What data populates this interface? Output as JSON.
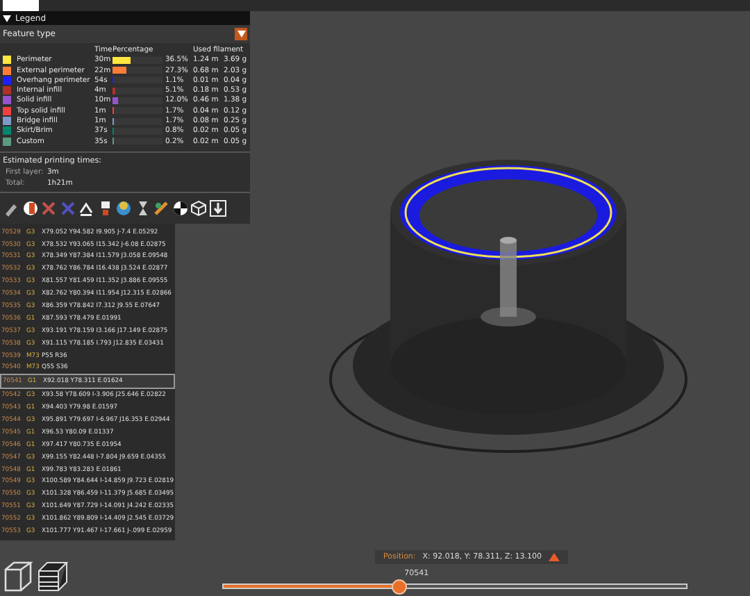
{
  "legend": {
    "title": "Legend",
    "expanded": true,
    "view_type": "Feature type",
    "columns": [
      "Time",
      "Percentage",
      "Used filament"
    ],
    "features": [
      {
        "name": "Perimeter",
        "color": "#ffe640",
        "time": "30m",
        "level": 0.365,
        "percentage": "36.5%",
        "length": "1.24 m",
        "weight": "3.69 g"
      },
      {
        "name": "External perimeter",
        "color": "#ff7d38",
        "time": "22m",
        "level": 0.273,
        "percentage": "27.3%",
        "length": "0.68 m",
        "weight": "2.03 g"
      },
      {
        "name": "Overhang perimeter",
        "color": "#1f1fff",
        "time": "54s",
        "level": 0.011,
        "percentage": "1.1%",
        "length": "0.01 m",
        "weight": "0.04 g"
      },
      {
        "name": "Internal infill",
        "color": "#b03029",
        "time": "4m",
        "level": 0.051,
        "percentage": "5.1%",
        "length": "0.18 m",
        "weight": "0.53 g"
      },
      {
        "name": "Solid infill",
        "color": "#9654cc",
        "time": "10m",
        "level": 0.12,
        "percentage": "12.0%",
        "length": "0.46 m",
        "weight": "1.38 g"
      },
      {
        "name": "Top solid infill",
        "color": "#f04040",
        "time": "1m",
        "level": 0.017,
        "percentage": "1.7%",
        "length": "0.04 m",
        "weight": "0.12 g"
      },
      {
        "name": "Bridge infill",
        "color": "#7f99c8",
        "time": "1m",
        "level": 0.017,
        "percentage": "1.7%",
        "length": "0.08 m",
        "weight": "0.25 g"
      },
      {
        "name": "Skirt/Brim",
        "color": "#00876e",
        "time": "37s",
        "level": 0.008,
        "percentage": "0.8%",
        "length": "0.02 m",
        "weight": "0.05 g"
      },
      {
        "name": "Custom",
        "color": "#5e9a80",
        "time": "35s",
        "level": 0.002,
        "percentage": "0.2%",
        "length": "0.02 m",
        "weight": "0.05 g"
      }
    ],
    "times_title": "Estimated printing times:",
    "times": [
      {
        "label": "First layer:",
        "value": "3m"
      },
      {
        "label": "Total:",
        "value": "1h21m"
      }
    ]
  },
  "gcode": [
    {
      "line": "70529",
      "code": "G3",
      "args": "X79.052 Y94.582 I9.905 J-7.4 E.05292",
      "selected": false
    },
    {
      "line": "70530",
      "code": "G3",
      "args": "X78.532 Y93.065 I15.342 J-6.08 E.02875",
      "selected": false
    },
    {
      "line": "70531",
      "code": "G3",
      "args": "X78.349 Y87.384 I11.579 J3.058 E.09548",
      "selected": false
    },
    {
      "line": "70532",
      "code": "G3",
      "args": "X78.762 Y86.784 I16.438 J3.524 E.02877",
      "selected": false
    },
    {
      "line": "70533",
      "code": "G3",
      "args": "X81.557 Y81.459 I11.352 J3.886 E.09555",
      "selected": false
    },
    {
      "line": "70534",
      "code": "G3",
      "args": "X82.762 Y80.394 I11.954 J12.315 E.02866",
      "selected": false
    },
    {
      "line": "70535",
      "code": "G3",
      "args": "X86.359 Y78.842 I7.312 J9.55 E.07647",
      "selected": false
    },
    {
      "line": "70536",
      "code": "G1",
      "args": "X87.593 Y78.479 E.01991",
      "selected": false
    },
    {
      "line": "70537",
      "code": "G3",
      "args": "X93.191 Y78.159 I3.166 J17.149 E.02875",
      "selected": false
    },
    {
      "line": "70538",
      "code": "G3",
      "args": "X91.115 Y78.185 I.793 J12.835 E.03431",
      "selected": false
    },
    {
      "line": "70539",
      "code": "M73",
      "args": "P55 R36",
      "selected": false
    },
    {
      "line": "70540",
      "code": "M73",
      "args": "Q55 S36",
      "selected": false
    },
    {
      "line": "70541",
      "code": "G1",
      "args": "X92.018 Y78.311 E.01624",
      "selected": true
    },
    {
      "line": "70542",
      "code": "G3",
      "args": "X93.58 Y78.609 I-3.906 J25.646 E.02822",
      "selected": false
    },
    {
      "line": "70543",
      "code": "G1",
      "args": "X94.403 Y79.98 E.01597",
      "selected": false
    },
    {
      "line": "70544",
      "code": "G3",
      "args": "X95.891 Y79.697 I-6.967 J16.353 E.02944",
      "selected": false
    },
    {
      "line": "70545",
      "code": "G1",
      "args": "X96.53 Y80.09 E.01337",
      "selected": false
    },
    {
      "line": "70546",
      "code": "G1",
      "args": "X97.417 Y80.735 E.01954",
      "selected": false
    },
    {
      "line": "70547",
      "code": "G3",
      "args": "X99.155 Y82.448 I-7.804 J9.659 E.04355",
      "selected": false
    },
    {
      "line": "70548",
      "code": "G1",
      "args": "X99.783 Y83.283 E.01861",
      "selected": false
    },
    {
      "line": "70549",
      "code": "G3",
      "args": "X100.589 Y84.644 I-14.859 J9.723 E.02819",
      "selected": false
    },
    {
      "line": "70550",
      "code": "G3",
      "args": "X101.328 Y86.459 I-11.379 J5.685 E.03495",
      "selected": false
    },
    {
      "line": "70551",
      "code": "G3",
      "args": "X101.649 Y87.729 I-14.091 J4.242 E.02335",
      "selected": false
    },
    {
      "line": "70552",
      "code": "G3",
      "args": "X101.862 Y89.809 I-14.409 J2.545 E.03729",
      "selected": false
    },
    {
      "line": "70553",
      "code": "G3",
      "args": "X101.777 Y91.467 I-17.661 J-.099 E.02959",
      "selected": false
    }
  ],
  "position": {
    "label": "Position:",
    "value": "X: 92.018, Y: 78.311, Z: 13.100"
  },
  "move_slider": {
    "value": "70541",
    "level": 0.38
  }
}
